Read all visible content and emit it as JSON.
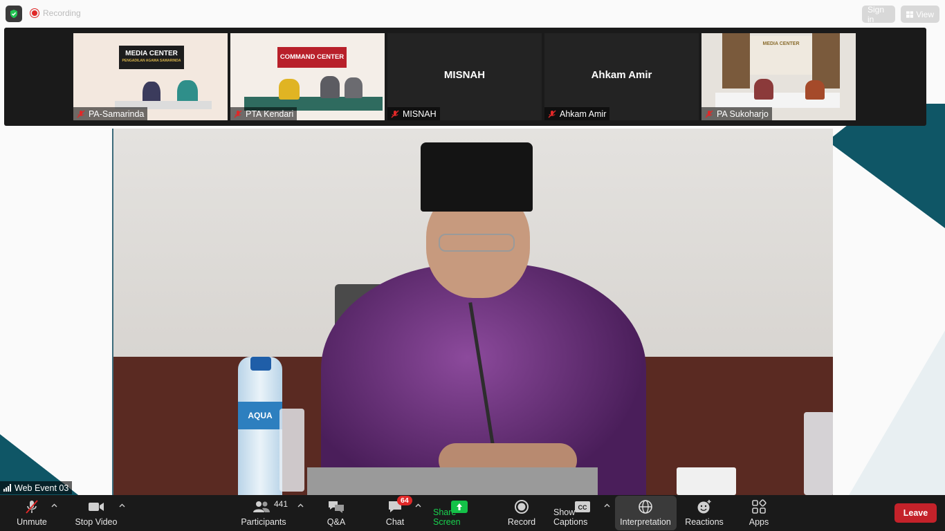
{
  "top_bar": {
    "recording_label": "Recording",
    "signin_label": "Sign in",
    "view_label": "View"
  },
  "gallery": {
    "tiles": [
      {
        "name": "PA-Samarinda",
        "video_on": true,
        "banner": "MEDIA CENTER",
        "banner_sub": "PENGADILAN AGAMA SAMARINDA"
      },
      {
        "name": "PTA Kendari",
        "video_on": true,
        "banner": "COMMAND CENTER"
      },
      {
        "name": "MISNAH",
        "video_on": false
      },
      {
        "name": "Ahkam Amir",
        "video_on": false
      },
      {
        "name": "PA Sukoharjo",
        "video_on": true,
        "banner": "MEDIA CENTER"
      }
    ]
  },
  "speaker": {
    "name": "Web Event 03",
    "bottle_label": "AQUA"
  },
  "toolbar": {
    "unmute_label": "Unmute",
    "stop_video_label": "Stop Video",
    "participants_label": "Participants",
    "participants_count": "441",
    "qa_label": "Q&A",
    "chat_label": "Chat",
    "chat_badge": "64",
    "share_label": "Share Screen",
    "record_label": "Record",
    "captions_label": "Show Captions",
    "interpretation_label": "Interpretation",
    "reactions_label": "Reactions",
    "apps_label": "Apps",
    "leave_label": "Leave"
  },
  "colors": {
    "toolbar_bg": "#1a1a1a",
    "share_green": "#14c148",
    "leave_red": "#c4222a",
    "badge_red": "#e02828",
    "accent_teal": "#0f5666"
  }
}
